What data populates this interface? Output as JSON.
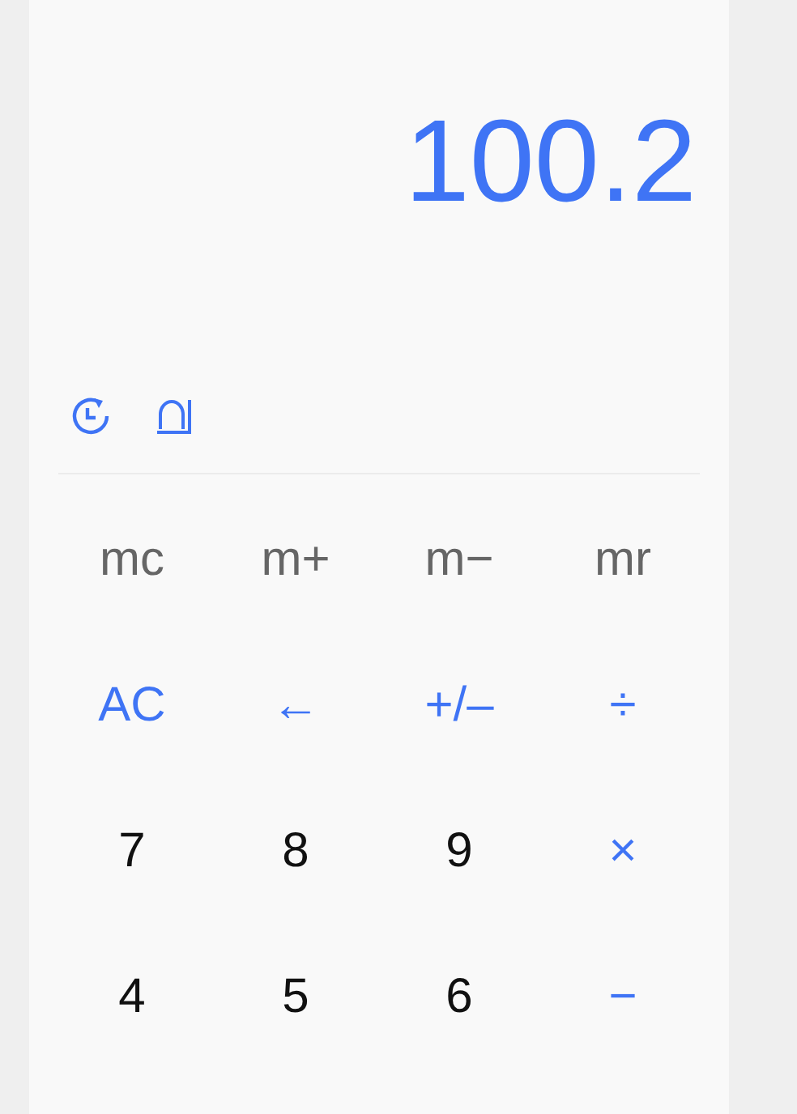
{
  "display": {
    "value": "100.2"
  },
  "tools": [
    {
      "kind": "history"
    },
    {
      "kind": "function"
    }
  ],
  "keys": [
    {
      "label": "mc",
      "kind": "memory"
    },
    {
      "label": "m+",
      "kind": "memory"
    },
    {
      "label": "m−",
      "kind": "memory"
    },
    {
      "label": "mr",
      "kind": "memory"
    },
    {
      "label": "AC",
      "kind": "operator"
    },
    {
      "label": "←",
      "kind": "operator"
    },
    {
      "label": "+/–",
      "kind": "operator"
    },
    {
      "label": "÷",
      "kind": "operator"
    },
    {
      "label": "7",
      "kind": "digit"
    },
    {
      "label": "8",
      "kind": "digit"
    },
    {
      "label": "9",
      "kind": "digit"
    },
    {
      "label": "×",
      "kind": "operator"
    },
    {
      "label": "4",
      "kind": "digit"
    },
    {
      "label": "5",
      "kind": "digit"
    },
    {
      "label": "6",
      "kind": "digit"
    },
    {
      "label": "−",
      "kind": "operator"
    }
  ]
}
